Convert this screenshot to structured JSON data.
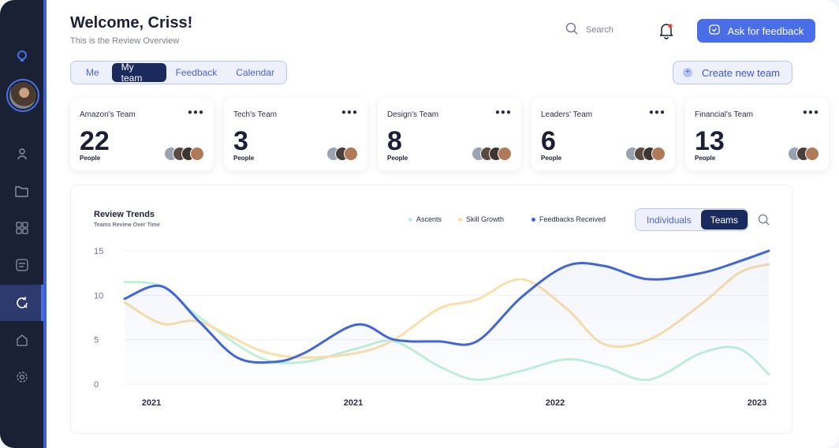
{
  "header": {
    "title": "Welcome, Criss!",
    "subtitle": "This is the Review Overview",
    "search_placeholder": "Search",
    "ask_button": "Ask for feedback"
  },
  "tabs": [
    {
      "label": "Me",
      "active": false
    },
    {
      "label": "My team",
      "active": true
    },
    {
      "label": "Feedback",
      "active": false
    },
    {
      "label": "Calendar",
      "active": false
    }
  ],
  "create_button": "Create new team",
  "teams": [
    {
      "name": "Amazon's Team",
      "count": "22",
      "unit": "People",
      "faces": 4
    },
    {
      "name": "Tech's Team",
      "count": "3",
      "unit": "People",
      "faces": 3
    },
    {
      "name": "Design's Team",
      "count": "8",
      "unit": "People",
      "faces": 4
    },
    {
      "name": "Leaders' Team",
      "count": "6",
      "unit": "People",
      "faces": 4
    },
    {
      "name": "Financial's Team",
      "count": "13",
      "unit": "People",
      "faces": 3
    }
  ],
  "chart_panel": {
    "title": "Review Trends",
    "subtitle": "Teams Review Over Time",
    "toggle": [
      {
        "label": "Individuals",
        "active": false
      },
      {
        "label": "Teams",
        "active": true
      }
    ]
  },
  "sidebar_icons": [
    "logo-icon",
    "user-icon",
    "folder-icon",
    "grid-icon",
    "chat-icon",
    "refresh-icon",
    "home-icon",
    "gear-icon"
  ],
  "colors": {
    "accent": "#4a6ee8",
    "navy": "#1b2a5c",
    "sidebar": "#1b2134",
    "ascents": "#bff0d8",
    "skill_growth": "#f9dfa9",
    "feedbacks": "#4266d6"
  },
  "chart_data": {
    "type": "line",
    "x_labels": [
      "2021",
      "2021",
      "2022",
      "2023"
    ],
    "ylim": [
      0,
      15
    ],
    "y_ticks": [
      0,
      5,
      10,
      15
    ],
    "grid": true,
    "legend_position": "top-right",
    "series": [
      {
        "name": "Ascents",
        "color": "#bff0d8",
        "x": [
          0,
          0.5,
          1.0,
          1.8,
          2.4,
          3.1,
          3.6,
          4.2,
          4.7,
          5.3,
          5.9,
          6.4,
          7.0,
          7.7,
          8.2,
          8.6
        ],
        "y": [
          11.5,
          11.0,
          7.5,
          3.0,
          2.5,
          4.0,
          4.8,
          2.0,
          0.5,
          1.5,
          2.8,
          2.0,
          0.5,
          3.5,
          4.0,
          1.1
        ]
      },
      {
        "name": "Skill Growth",
        "color": "#f9dfa9",
        "x": [
          0,
          0.5,
          1.0,
          1.8,
          2.4,
          3.1,
          3.6,
          4.2,
          4.7,
          5.3,
          5.9,
          6.4,
          7.0,
          7.7,
          8.2,
          8.6
        ],
        "y": [
          9.2,
          6.8,
          7.0,
          3.8,
          3.0,
          3.5,
          5.0,
          8.5,
          9.5,
          11.8,
          8.5,
          4.5,
          5.0,
          9.0,
          12.5,
          13.5
        ]
      },
      {
        "name": "Feedbacks Received",
        "color": "#4266d6",
        "x": [
          0,
          0.5,
          1.0,
          1.5,
          2.0,
          2.4,
          3.1,
          3.6,
          4.2,
          4.7,
          5.3,
          5.9,
          6.4,
          7.0,
          7.7,
          8.2,
          8.6
        ],
        "y": [
          9.6,
          11.0,
          7.0,
          3.0,
          2.5,
          3.5,
          6.7,
          5.0,
          4.8,
          4.8,
          9.8,
          13.3,
          13.3,
          11.8,
          12.5,
          13.8,
          15.0
        ]
      }
    ]
  }
}
